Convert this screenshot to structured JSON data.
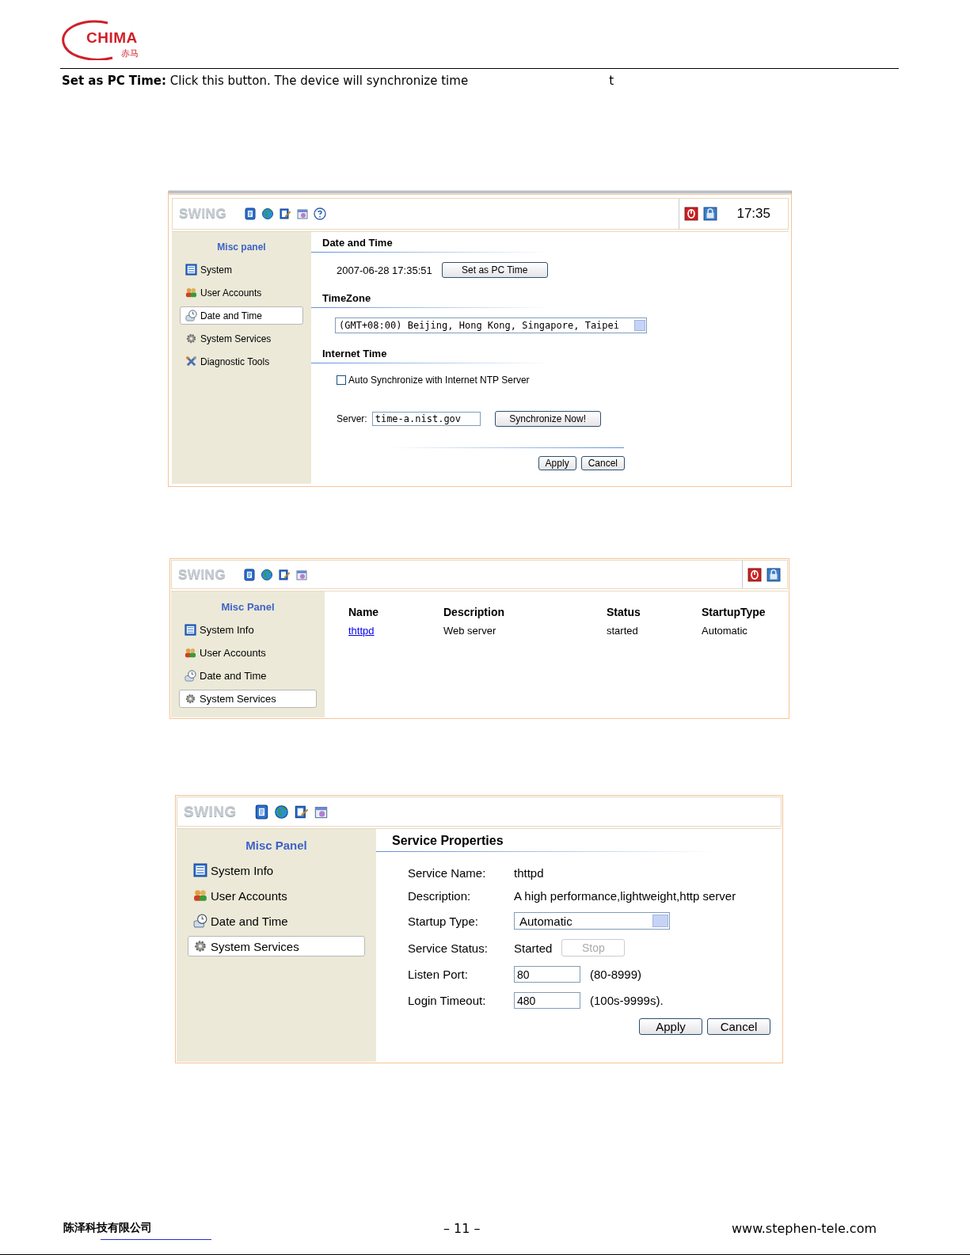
{
  "header": {
    "logo": "CHIMA",
    "logo_subtitle": "赤马"
  },
  "intro": {
    "label": "Set as PC Time:",
    "text": "Click this button. The device will synchronize time",
    "fragment": "t"
  },
  "screens": [
    {
      "kind": "date_time",
      "toolbar": {
        "brand": "SWING",
        "help": true,
        "power_controls": true,
        "clock": "17:35"
      },
      "sidebar": {
        "title": "Misc panel",
        "items": [
          {
            "label": "System",
            "selected": false
          },
          {
            "label": "User Accounts",
            "selected": false
          },
          {
            "label": "Date and Time",
            "selected": true
          },
          {
            "label": "System Services",
            "selected": false
          },
          {
            "label": "Diagnostic Tools",
            "selected": false
          }
        ]
      },
      "content": {
        "date_heading": "Date and Time",
        "current_time": "2007-06-28 17:35:51",
        "set_pc_time_button": "Set as PC Time",
        "timezone_heading": "TimeZone",
        "timezone": "(GMT+08:00) Beijing, Hong Kong, Singapore, Taipei",
        "internet_heading": "Internet Time",
        "auto_sync": {
          "label": "Auto Synchronize with Internet NTP Server",
          "checked": false
        },
        "server": {
          "label": "Server:",
          "value": "time-a.nist.gov"
        },
        "sync_button": "Synchronize Now!",
        "buttons": [
          "Apply",
          "Cancel"
        ]
      }
    },
    {
      "kind": "services_list",
      "toolbar": {
        "brand": "SWING",
        "power_controls": true
      },
      "sidebar": {
        "title": "Misc Panel",
        "items": [
          {
            "label": "System Info",
            "selected": false
          },
          {
            "label": "User Accounts",
            "selected": false
          },
          {
            "label": "Date and Time",
            "selected": false
          },
          {
            "label": "System Services",
            "selected": true
          }
        ]
      },
      "content": {
        "columns": [
          "Name",
          "Description",
          "Status",
          "StartupType"
        ],
        "rows": [
          [
            "thttpd",
            "Web server",
            "started",
            "Automatic"
          ]
        ]
      }
    },
    {
      "kind": "service_properties",
      "toolbar": {
        "brand": "SWING"
      },
      "sidebar": {
        "title": "Misc Panel",
        "items": [
          {
            "label": "System Info",
            "selected": false
          },
          {
            "label": "User Accounts",
            "selected": false
          },
          {
            "label": "Date and Time",
            "selected": false
          },
          {
            "label": "System Services",
            "selected": true
          }
        ]
      },
      "content": {
        "heading": "Service Properties",
        "fields": [
          {
            "kind": "text",
            "label": "Service Name:",
            "value": "thttpd"
          },
          {
            "kind": "text",
            "label": "Description:",
            "value": "A high performance,lightweight,http server"
          },
          {
            "kind": "select",
            "label": "Startup Type:",
            "value": "Automatic"
          },
          {
            "kind": "status",
            "label": "Service Status:",
            "value": "Started",
            "button": {
              "label": "Stop",
              "disabled": true
            }
          },
          {
            "kind": "input",
            "label": "Listen Port:",
            "value": "80",
            "hint": "(80-8999)"
          },
          {
            "kind": "input",
            "label": "Login Timeout:",
            "value": "480",
            "hint": "(100s-9999s)."
          }
        ],
        "buttons": [
          "Apply",
          "Cancel"
        ]
      }
    }
  ],
  "footer": {
    "company": "陈泽科技有限公司",
    "page": "– 11 –",
    "website": "www.stephen-tele.com"
  }
}
